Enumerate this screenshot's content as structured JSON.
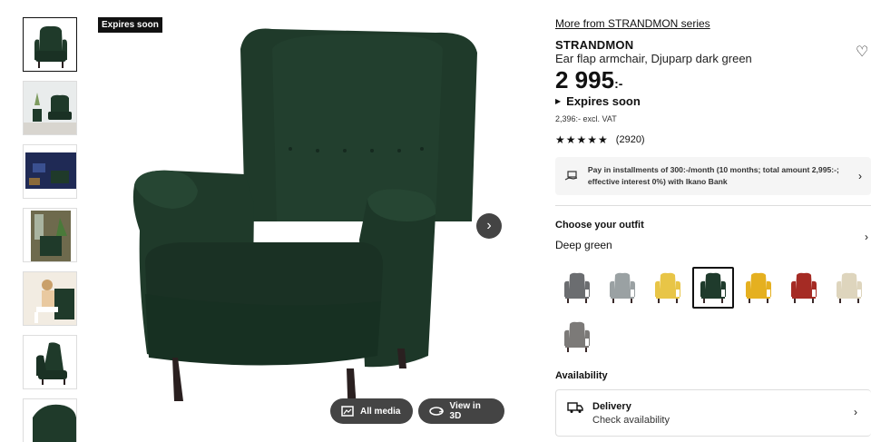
{
  "badge": "Expires soon",
  "thumbnails": [
    {
      "name": "thumb-product-front"
    },
    {
      "name": "thumb-room-scene"
    },
    {
      "name": "thumb-dark-room"
    },
    {
      "name": "thumb-corner"
    },
    {
      "name": "thumb-person-sitting"
    },
    {
      "name": "thumb-product-side"
    },
    {
      "name": "thumb-product-detail"
    }
  ],
  "media": {
    "all_media": "All media",
    "view_3d": "View in 3D"
  },
  "product": {
    "series_link": "More from STRANDMON series",
    "name": "STRANDMON",
    "description": "Ear flap armchair, Djuparp dark green",
    "price": "2 995",
    "price_suffix": ":-",
    "expires": "Expires soon",
    "vat_text": "2,396:- excl. VAT",
    "rating_count": "(2920)",
    "rating_value": 4.5
  },
  "installments": {
    "text": "Pay in installments of 300:-/month (10 months; total amount 2,995:-; effective interest 0%) with Ikano Bank"
  },
  "outfit": {
    "title": "Choose your outfit",
    "selected": "Deep green",
    "swatches": [
      {
        "name": "swatch-dark-grey",
        "color": "#6b6d70"
      },
      {
        "name": "swatch-light-grey-pattern",
        "color": "#9aa1a3"
      },
      {
        "name": "swatch-yellow-light",
        "color": "#e8c547"
      },
      {
        "name": "swatch-deep-green",
        "color": "#1f3b2c",
        "selected": true
      },
      {
        "name": "swatch-yellow",
        "color": "#e5b020"
      },
      {
        "name": "swatch-red",
        "color": "#a52b24"
      },
      {
        "name": "swatch-beige",
        "color": "#ded5bd"
      },
      {
        "name": "swatch-grey",
        "color": "#7c7a78"
      }
    ]
  },
  "availability": {
    "title": "Availability",
    "delivery_title": "Delivery",
    "delivery_sub": "Check availability"
  },
  "colors": {
    "chair_green": "#1f3a2a",
    "chair_green_dark": "#162a1f",
    "legs": "#2a2020"
  }
}
